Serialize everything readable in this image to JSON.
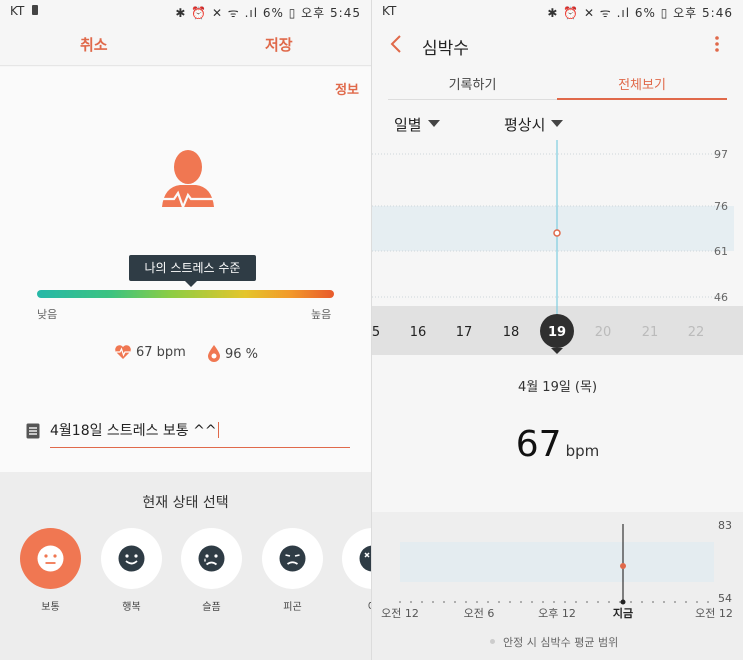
{
  "left": {
    "status": {
      "carrier": "KT",
      "right": "✱ ⏰ ✕ ᯤ .ıl 6% ▯ 오후 5:45"
    },
    "header": {
      "cancel": "취소",
      "save": "저장"
    },
    "info_link": "정보",
    "tooltip": "나의 스트레스 수준",
    "stress_level": 0.53,
    "scale": {
      "low": "낮음",
      "high": "높음"
    },
    "heart_rate": "67 bpm",
    "spo2": "96 %",
    "memo": "4월18일 스트레스 보통 ^^",
    "section_title": "현재 상태 선택",
    "moods": [
      {
        "label": "보통",
        "icon": "neutral-face-icon",
        "selected": true
      },
      {
        "label": "행복",
        "icon": "happy-face-icon",
        "selected": false
      },
      {
        "label": "슬픔",
        "icon": "sad-face-icon",
        "selected": false
      },
      {
        "label": "피곤",
        "icon": "tired-face-icon",
        "selected": false
      },
      {
        "label": "어",
        "icon": "angry-face-icon",
        "selected": false
      }
    ],
    "colors": {
      "accent": "#e0694a",
      "mood_selected": "#f07752"
    }
  },
  "right": {
    "status": {
      "carrier": "KT",
      "right": "✱ ⏰ ✕ ᯤ .ıl 6% ▯ 오후 5:46"
    },
    "title": "심박수",
    "tabs": [
      {
        "label": "기록하기",
        "active": false
      },
      {
        "label": "전체보기",
        "active": true
      }
    ],
    "filters": {
      "period": "일별",
      "mode": "평상시"
    },
    "chart": {
      "y_ticks": [
        97,
        76,
        61,
        46
      ],
      "band": [
        61,
        76
      ],
      "value": 67,
      "days": [
        "5",
        "16",
        "17",
        "18",
        "19",
        "20",
        "21",
        "22"
      ],
      "selected_day": "19"
    },
    "date": "4월 19일 (목)",
    "bpm_value": "67",
    "bpm_unit": "bpm",
    "mini": {
      "y_top": "83",
      "y_bottom": "54",
      "x_labels": [
        "오전 12",
        "오전 6",
        "오후 12",
        "지금",
        "오전 12"
      ],
      "legend": "안정 시 심박수 평균 범위"
    }
  }
}
